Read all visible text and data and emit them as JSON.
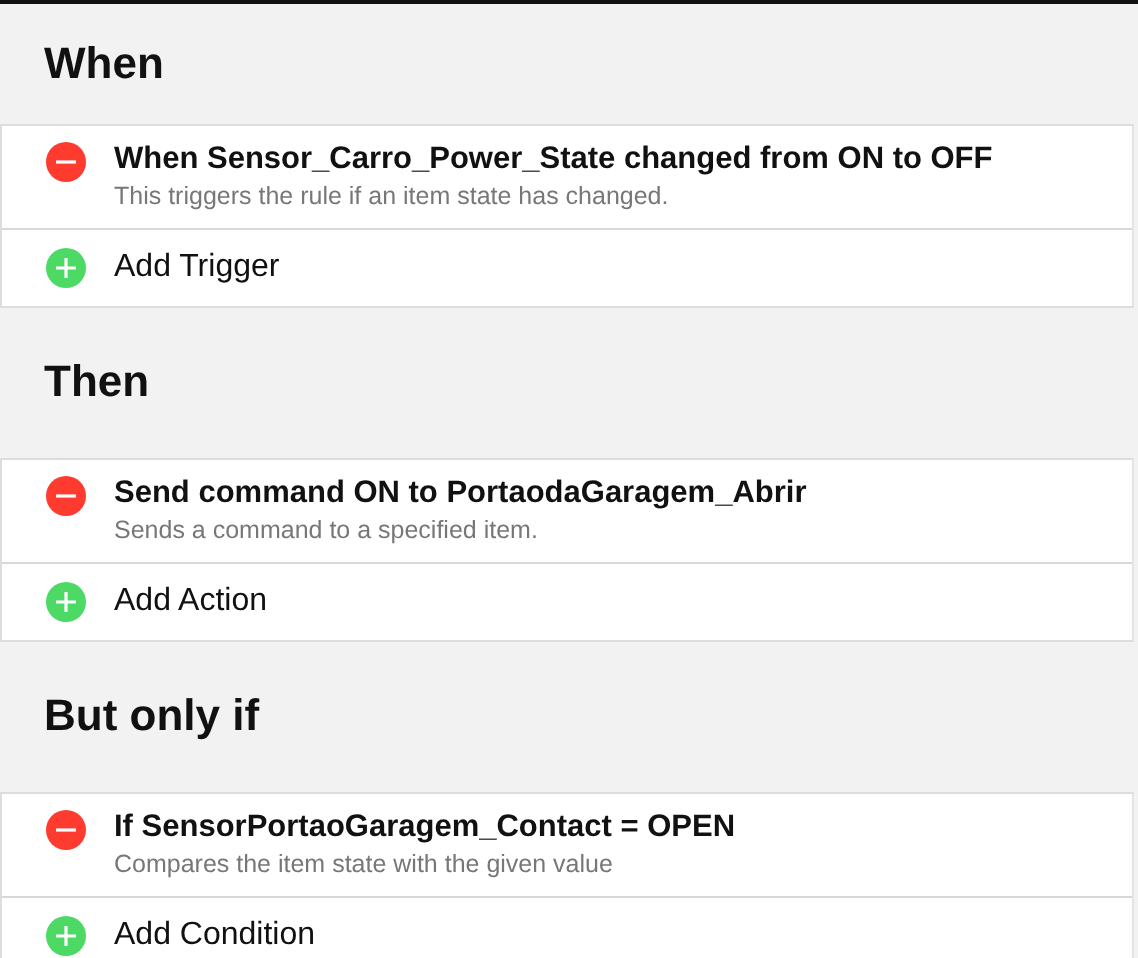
{
  "sections": [
    {
      "title": "When",
      "items": [
        {
          "kind": "rule",
          "title": "When Sensor_Carro_Power_State changed from ON to OFF",
          "description": "This triggers the rule if an item state has changed."
        },
        {
          "kind": "add",
          "label": "Add Trigger"
        }
      ]
    },
    {
      "title": "Then",
      "items": [
        {
          "kind": "rule",
          "title": "Send command ON to PortaodaGaragem_Abrir",
          "description": "Sends a command to a specified item."
        },
        {
          "kind": "add",
          "label": "Add Action"
        }
      ]
    },
    {
      "title": "But only if",
      "items": [
        {
          "kind": "rule",
          "title": "If SensorPortaoGaragem_Contact = OPEN",
          "description": "Compares the item state with the given value"
        },
        {
          "kind": "add",
          "label": "Add Condition"
        }
      ]
    }
  ]
}
